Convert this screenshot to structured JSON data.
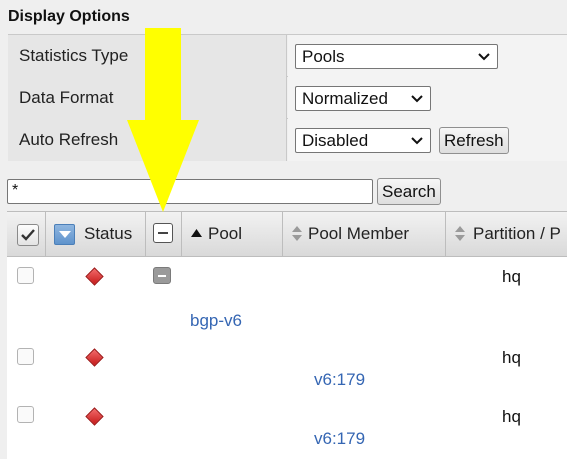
{
  "section": {
    "title": "Display Options"
  },
  "options": [
    {
      "label": "Statistics Type",
      "value": "Pools"
    },
    {
      "label": "Data Format",
      "value": "Normalized"
    },
    {
      "label": "Auto Refresh",
      "value": "Disabled",
      "button": "Refresh"
    }
  ],
  "search": {
    "value": "*",
    "button": "Search"
  },
  "table": {
    "columns": {
      "status": "Status",
      "pool": "Pool",
      "pool_member": "Pool Member",
      "partition": "Partition / P"
    },
    "rows": [
      {
        "pool": "bgp-v6",
        "pool_member": "",
        "partition": "hq",
        "type": "pool"
      },
      {
        "pool": "",
        "pool_member": "v6:179",
        "partition": "hq",
        "type": "member"
      },
      {
        "pool": "",
        "pool_member": "v6:179",
        "partition": "hq",
        "type": "member"
      }
    ]
  },
  "icons": {
    "status": "red-diamond-status-icon",
    "pool_type": "collapse-minus-icon",
    "sort_pool": "sort-ascending-icon",
    "sort_other": "sort-both-icon",
    "annotation": "yellow-down-arrow"
  },
  "colors": {
    "link": "#3566b3",
    "status_offline": "#d12a2a",
    "annotation_arrow": "#ffff00"
  }
}
